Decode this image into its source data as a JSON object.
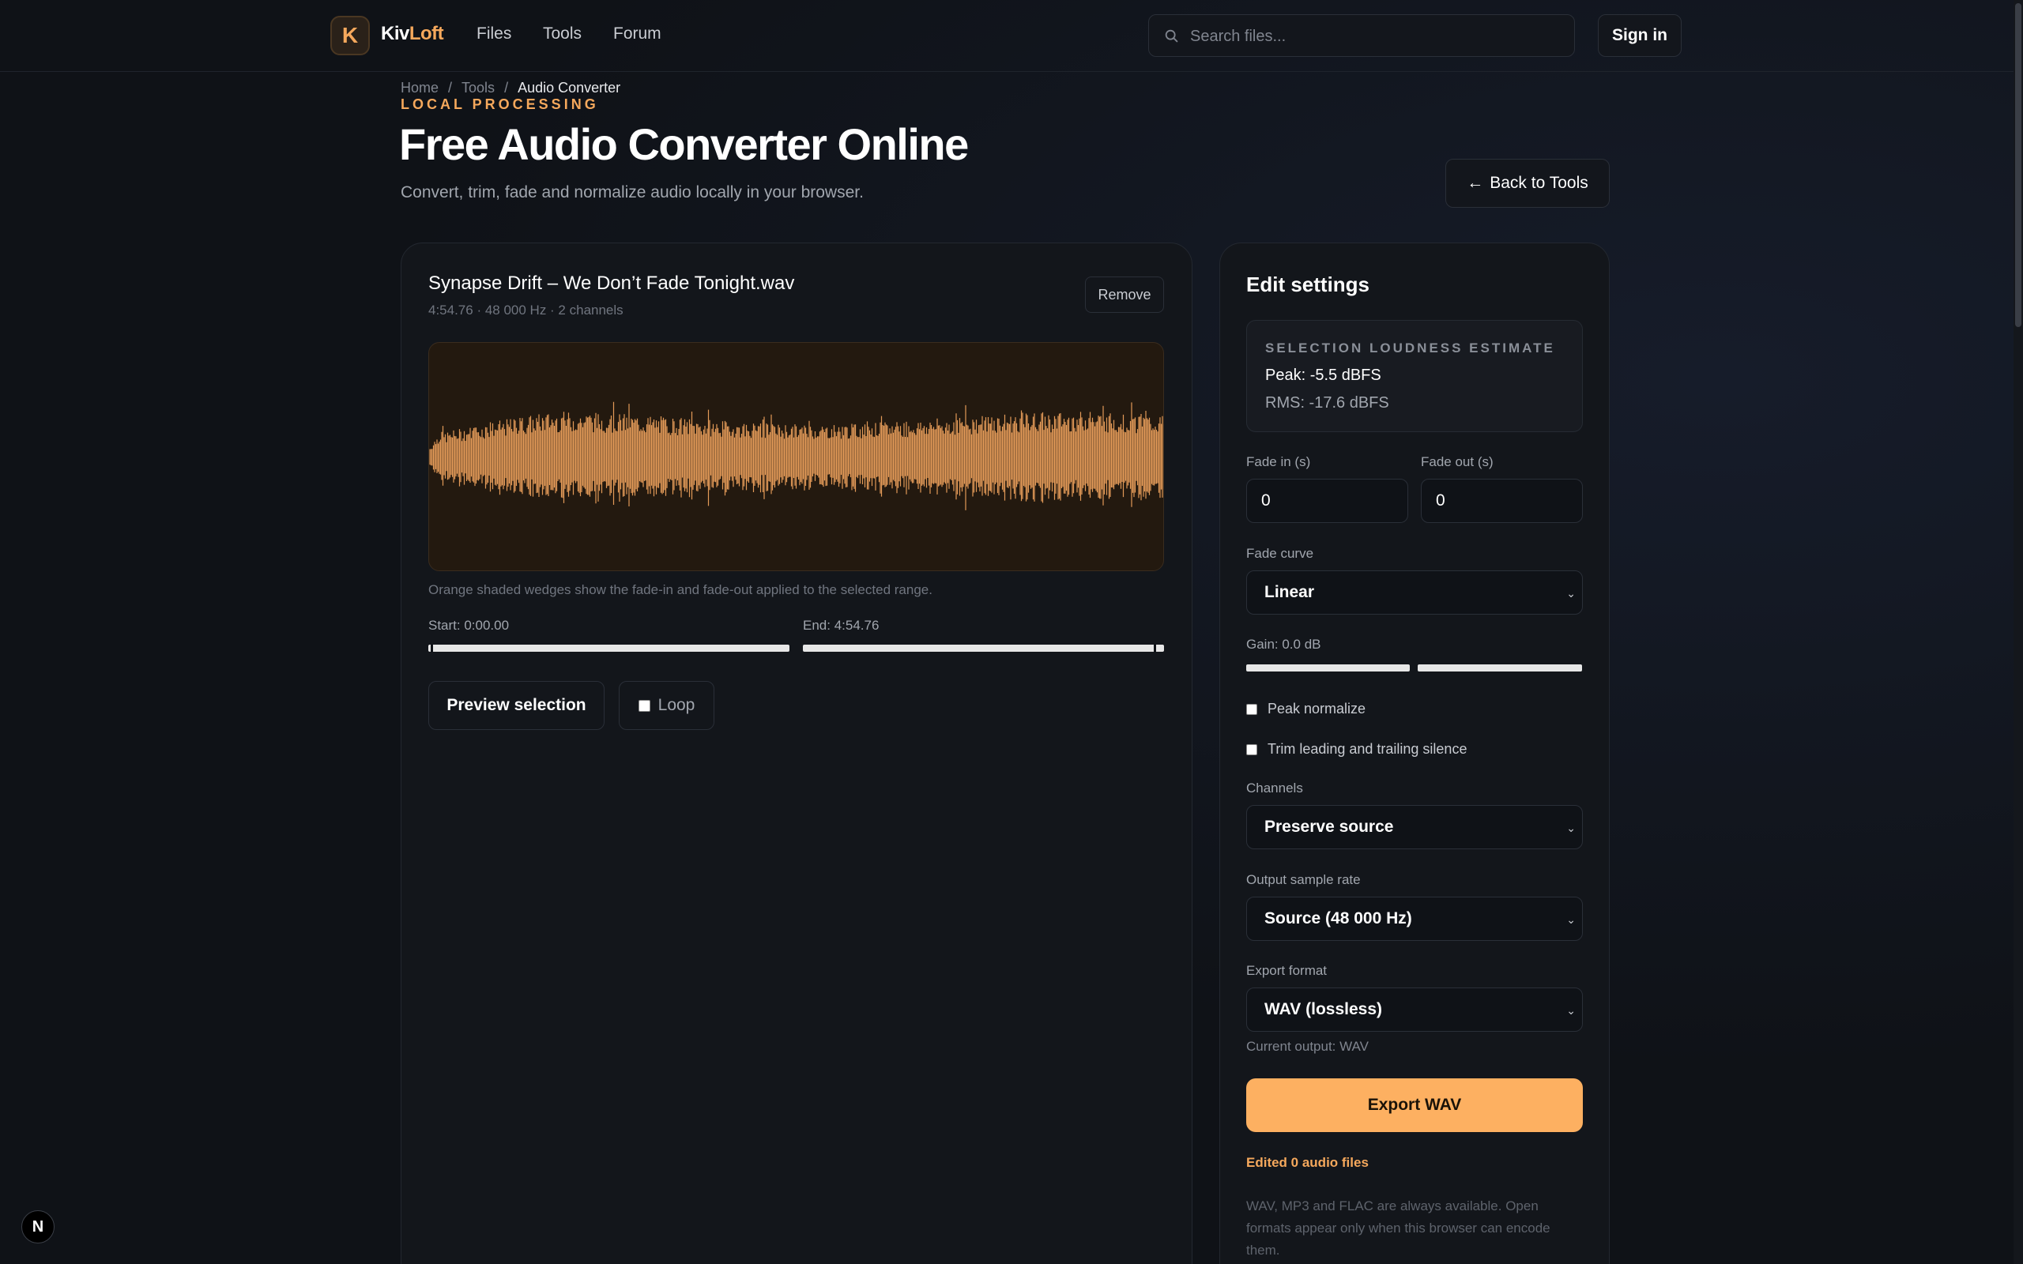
{
  "nav": {
    "logo_letter": "K",
    "brand_part1": "Kiv",
    "brand_part2": "Loft",
    "links": [
      "Files",
      "Tools",
      "Forum"
    ],
    "search_placeholder": "Search files...",
    "signin_label": "Sign in"
  },
  "breadcrumb": [
    "Home",
    "Tools",
    "Audio Converter"
  ],
  "header": {
    "eyebrow": "LOCAL PROCESSING",
    "title": "Free Audio Converter Online",
    "subtitle": "Convert, trim, fade and normalize audio locally in your browser.",
    "back_label": "Back to Tools"
  },
  "file": {
    "name": "Synapse Drift – We Don’t Fade Tonight.wav",
    "meta": "4:54.76 · 48 000 Hz · 2 channels",
    "remove_label": "Remove",
    "waveform_caption": "Orange shaded wedges show the fade-in and fade-out applied to the selected range.",
    "start_label": "Start: 0:00.00",
    "end_label": "End: 4:54.76",
    "preview_label": "Preview selection",
    "loop_label": "Loop",
    "loop_checked": false
  },
  "settings": {
    "title": "Edit settings",
    "loudness_heading": "SELECTION LOUDNESS ESTIMATE",
    "peak": "Peak: -5.5 dBFS",
    "rms": "RMS: -17.6 dBFS",
    "fade_in_label": "Fade in (s)",
    "fade_in_value": "0",
    "fade_out_label": "Fade out (s)",
    "fade_out_value": "0",
    "fade_curve_label": "Fade curve",
    "fade_curve_value": "Linear",
    "gain_label": "Gain: 0.0 dB",
    "peak_normalize_label": "Peak normalize",
    "peak_normalize_checked": false,
    "trim_silence_label": "Trim leading and trailing silence",
    "trim_silence_checked": false,
    "channels_label": "Channels",
    "channels_value": "Preserve source",
    "sample_rate_label": "Output sample rate",
    "sample_rate_value": "Source (48 000 Hz)",
    "format_label": "Export format",
    "format_value": "WAV (lossless)",
    "current_output": "Current output: WAV",
    "export_label": "Export WAV",
    "edited_count": "Edited 0 audio files",
    "formats_note": "WAV, MP3 and FLAC are always available. Open formats appear only when this browser can encode them."
  },
  "dev_badge": "N",
  "colors": {
    "accent": "#f5a85c",
    "export_button": "#fdb061",
    "waveform": "#e39a58",
    "background": "#0f1217"
  }
}
